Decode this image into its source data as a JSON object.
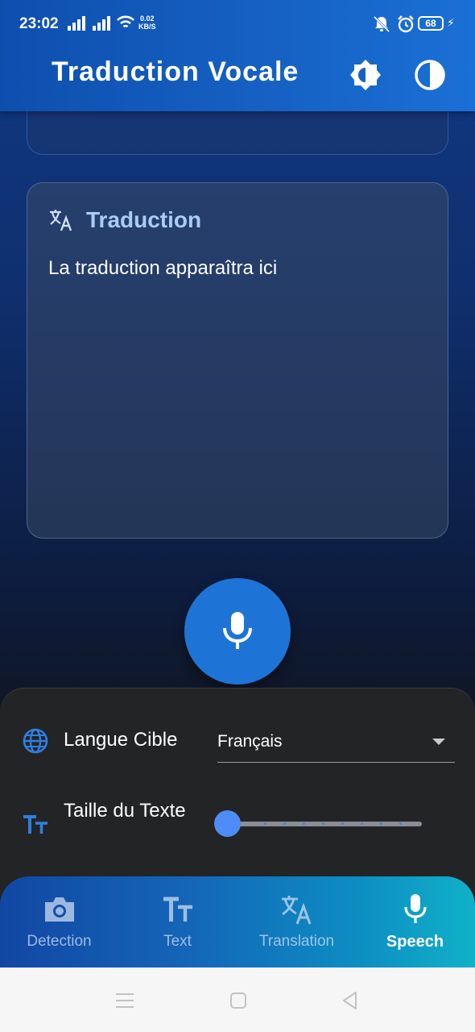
{
  "status_bar": {
    "time": "23:02",
    "net_speed_value": "0.02",
    "net_speed_unit": "KB/S",
    "battery": "68"
  },
  "app_bar": {
    "title": "Traduction Vocale",
    "icons": [
      "brightness-icon",
      "contrast-icon"
    ]
  },
  "translation_card": {
    "title": "Traduction",
    "placeholder_text": "La traduction apparaîtra ici",
    "icon": "translate-icon"
  },
  "mic_button": {
    "icon": "microphone-icon"
  },
  "settings": {
    "target_language_label": "Langue Cible",
    "target_language_value": "Français",
    "text_size_label": "Taille du Texte",
    "text_size_level": 0
  },
  "bottom_nav": {
    "items": [
      {
        "label": "Detection",
        "icon": "camera-icon",
        "active": false
      },
      {
        "label": "Text",
        "icon": "text-size-icon",
        "active": false
      },
      {
        "label": "Translation",
        "icon": "translate-icon",
        "active": false
      },
      {
        "label": "Speech",
        "icon": "microphone-icon",
        "active": true
      }
    ]
  },
  "colors": {
    "app_bar": "#1662c4",
    "accent": "#1e74d6",
    "card_title": "#a9cdf5",
    "panel": "#232425"
  }
}
